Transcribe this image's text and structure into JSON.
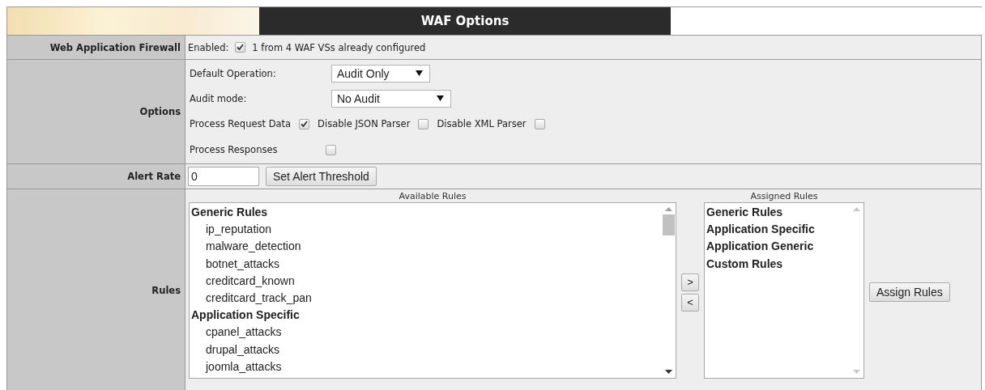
{
  "header": {
    "title": "WAF Options"
  },
  "firewall": {
    "label": "Web Application Firewall",
    "enabled_label": "Enabled:",
    "enabled": true,
    "status": "1 from 4 WAF VSs already configured"
  },
  "options": {
    "label": "Options",
    "selects": [
      {
        "label": "Default Operation:",
        "value": "Audit Only"
      },
      {
        "label": "Audit mode:",
        "value": "No Audit"
      }
    ],
    "check_rows": [
      [
        {
          "label": "Process Request Data",
          "checked": true
        },
        {
          "label": "Disable JSON Parser",
          "checked": false
        },
        {
          "label": "Disable XML Parser",
          "checked": false
        }
      ],
      [
        {
          "label": "Process Responses",
          "checked": false
        }
      ]
    ]
  },
  "alert": {
    "label": "Alert Rate",
    "value": "0",
    "button": "Set Alert Threshold"
  },
  "rules": {
    "label": "Rules",
    "available": {
      "title": "Available Rules",
      "items": [
        {
          "kind": "group",
          "text": "Generic Rules"
        },
        {
          "kind": "rule",
          "text": "ip_reputation"
        },
        {
          "kind": "rule",
          "text": "malware_detection"
        },
        {
          "kind": "rule",
          "text": "botnet_attacks"
        },
        {
          "kind": "rule",
          "text": "creditcard_known"
        },
        {
          "kind": "rule",
          "text": "creditcard_track_pan"
        },
        {
          "kind": "group",
          "text": "Application Specific"
        },
        {
          "kind": "rule",
          "text": "cpanel_attacks"
        },
        {
          "kind": "rule",
          "text": "drupal_attacks"
        },
        {
          "kind": "rule",
          "text": "joomla_attacks"
        }
      ]
    },
    "add_button": ">",
    "remove_button": "<",
    "assigned": {
      "title": "Assigned Rules",
      "items": [
        {
          "kind": "group",
          "text": "Generic Rules"
        },
        {
          "kind": "group",
          "text": "Application Specific"
        },
        {
          "kind": "group",
          "text": "Application Generic"
        },
        {
          "kind": "group",
          "text": "Custom Rules"
        }
      ]
    },
    "assign_button": "Assign Rules"
  }
}
